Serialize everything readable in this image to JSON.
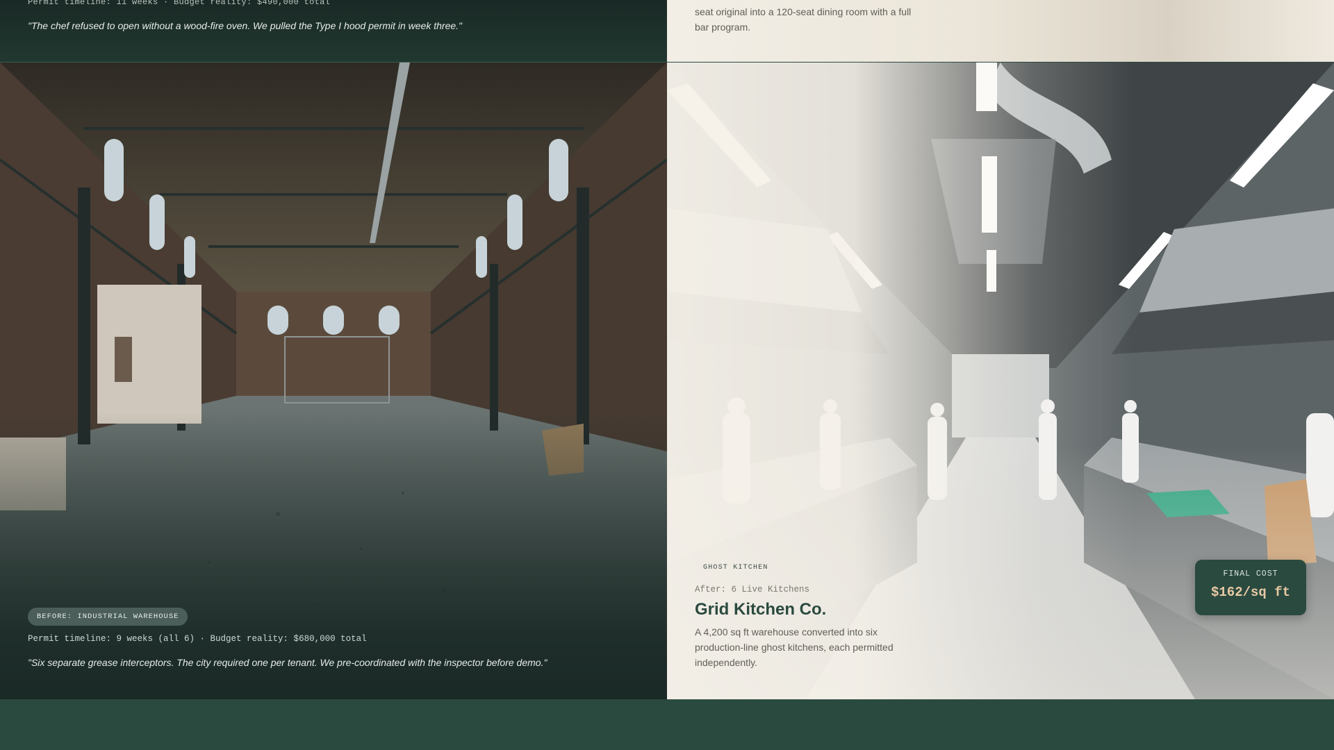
{
  "top_left": {
    "meta": "Permit timeline: 11 weeks · Budget reality: $490,000 total",
    "quote": "\"The chef refused to open without a wood-fire oven. We pulled the Type I hood permit in week three.\""
  },
  "top_right": {
    "description": "seat original into a 120-seat dining room with a full bar program."
  },
  "before_card": {
    "badge": "BEFORE: INDUSTRIAL WAREHOUSE",
    "meta": "Permit timeline: 9 weeks (all 6) · Budget reality: $680,000 total",
    "quote": "\"Six separate grease interceptors. The city required one per tenant. We pre-coordinated with the inspector before demo.\""
  },
  "after_card": {
    "tag": "GHOST KITCHEN",
    "after_label": "After: 6 Live Kitchens",
    "title": "Grid Kitchen Co.",
    "description": "A 4,200 sq ft warehouse converted into six production-line ghost kitchens, each permitted independently.",
    "final_cost_label": "FINAL COST",
    "final_cost_value": "$162/sq ft"
  },
  "colors": {
    "brand_green": "#2b4a3f",
    "accent_tan": "#e8c9a4",
    "cream": "#f2eee6"
  }
}
